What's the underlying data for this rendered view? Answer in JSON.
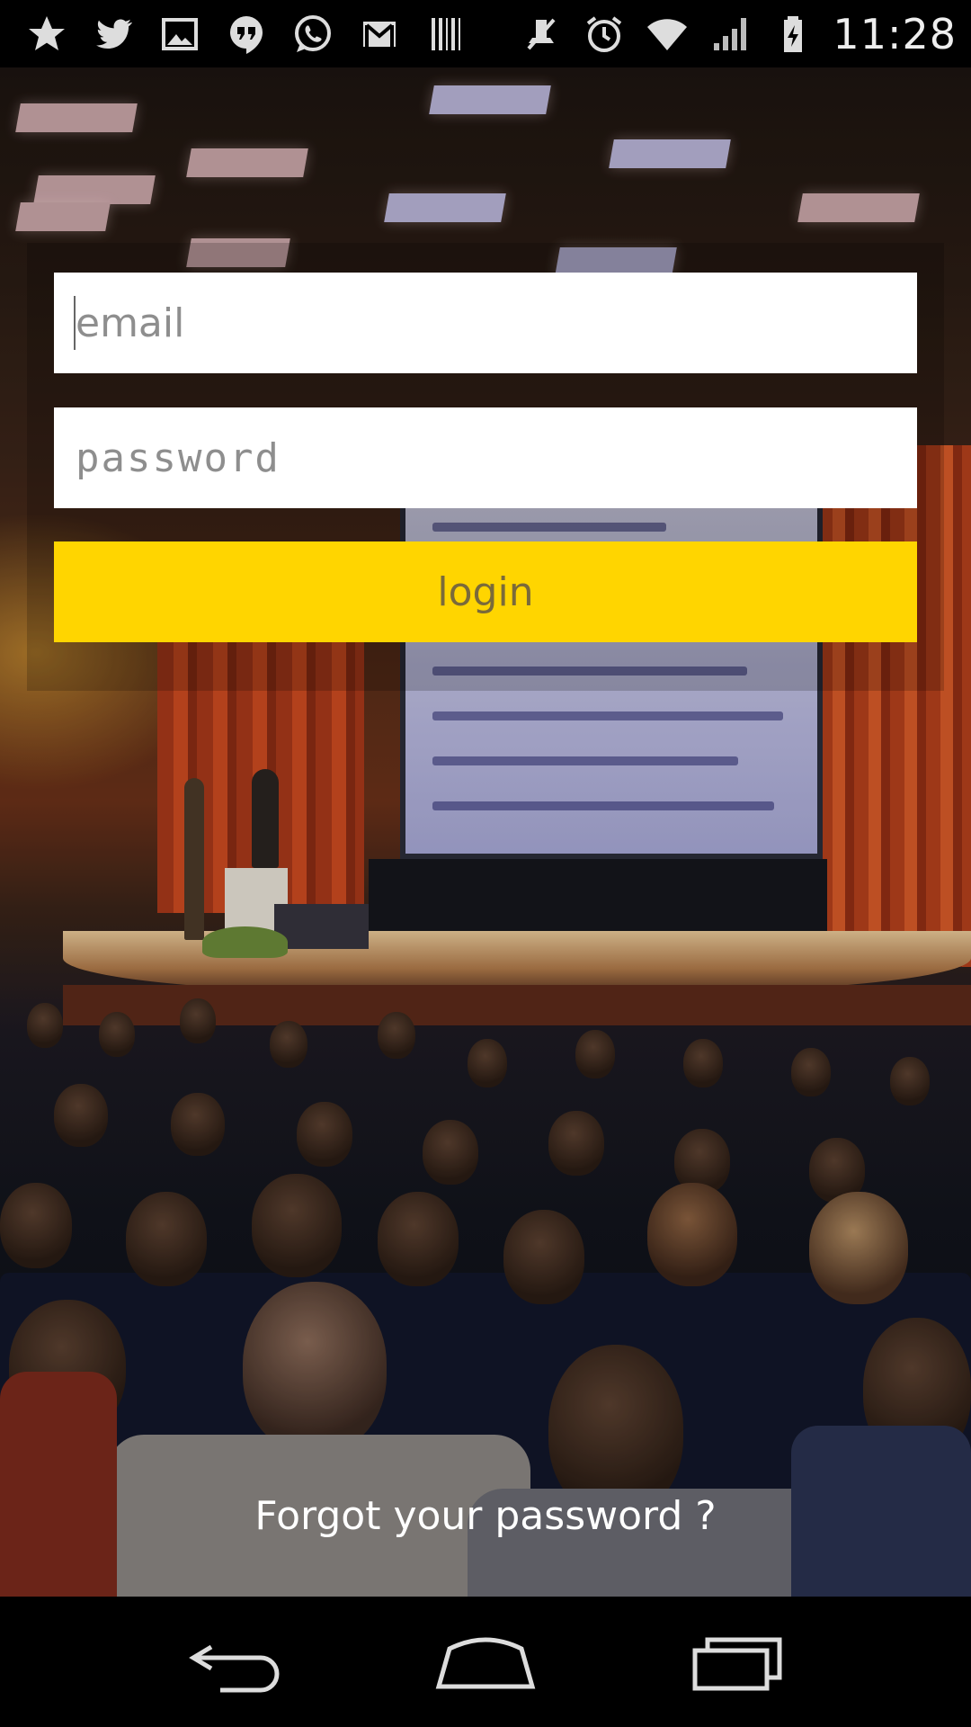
{
  "status_bar": {
    "left_icons": [
      "star-icon",
      "twitter-icon",
      "image-icon",
      "hangouts-icon",
      "whatsapp-icon",
      "gmail-icon",
      "barcode-icon"
    ],
    "right_icons": [
      "mute-icon",
      "alarm-icon",
      "wifi-icon",
      "signal-icon",
      "battery-charging-icon"
    ],
    "time": "11:28"
  },
  "login": {
    "email_placeholder": "email",
    "password_placeholder": "password",
    "login_label": "login"
  },
  "forgot_password_label": "Forgot your password ?",
  "nav_bar": {
    "buttons": [
      "back-icon",
      "home-icon",
      "recent-apps-icon"
    ]
  },
  "colors": {
    "accent": "#ffd500",
    "login_text": "#7a6a3a",
    "field_bg": "#ffffff",
    "placeholder": "#8e8e8e"
  }
}
